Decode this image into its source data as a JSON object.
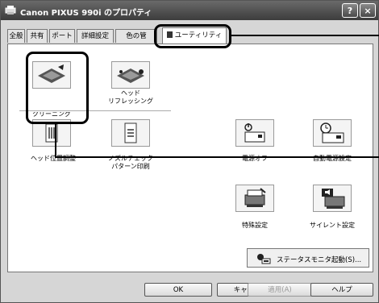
{
  "window": {
    "title": "Canon PIXUS 990i のプロパティ",
    "help_btn": "?",
    "close_btn": "×"
  },
  "tabs": [
    {
      "label": "全般"
    },
    {
      "label": "共有"
    },
    {
      "label": "ポート"
    },
    {
      "label": "詳細設定"
    },
    {
      "label": "色の管"
    },
    {
      "label": "ユーティリティ"
    }
  ],
  "utilities": {
    "cleaning": "クリーニング",
    "refresh_line1": "ヘッド",
    "refresh_line2": "リフレッシング",
    "head_align": "ヘッド位置調整",
    "nozzle_check_line1": "ノズルチェック",
    "nozzle_check_line2": "パターン印刷",
    "power_off": "電源オフ",
    "auto_power": "自動電源設定",
    "special_settings": "特殊設定",
    "silent_settings": "サイレント設定",
    "status_monitor": "ステータスモニタ起動(S)..."
  },
  "buttons": {
    "ok": "OK",
    "cancel": "キャンセル",
    "apply": "適用(A)",
    "help": "ヘルプ"
  },
  "colors": {
    "titlebar": "#4a4a4a",
    "callout": "#000000"
  }
}
